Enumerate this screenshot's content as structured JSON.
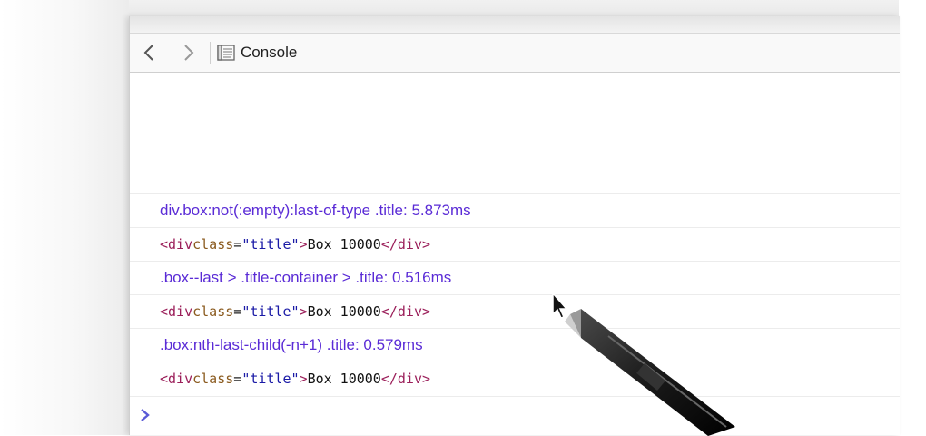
{
  "toolbar": {
    "back_icon": "chevron-left-icon",
    "forward_icon": "chevron-right-icon",
    "console_icon": "console-icon",
    "console_label": "Console"
  },
  "log": {
    "entries": [
      {
        "type": "message",
        "text": "div.box:not(:empty):last-of-type .title: 5.873ms"
      },
      {
        "type": "element",
        "tag_open": "<div",
        "attr_name": " class",
        "eq": "=",
        "attr_value": "\"title\"",
        "tag_close": ">",
        "text": "Box 10000",
        "end_tag": "</div>"
      },
      {
        "type": "message",
        "text": ".box--last > .title-container > .title: 0.516ms"
      },
      {
        "type": "element",
        "tag_open": "<div",
        "attr_name": " class",
        "eq": "=",
        "attr_value": "\"title\"",
        "tag_close": ">",
        "text": "Box 10000",
        "end_tag": "</div>"
      },
      {
        "type": "message",
        "text": ".box:nth-last-child(-n+1) .title: 0.579ms"
      },
      {
        "type": "element",
        "tag_open": "<div",
        "attr_name": " class",
        "eq": "=",
        "attr_value": "\"title\"",
        "tag_close": ">",
        "text": "Box 10000",
        "end_tag": "</div>"
      }
    ]
  },
  "prompt": {
    "icon": "prompt-chevron-icon"
  },
  "colors": {
    "message": "#5a2bd6",
    "tag": "#9b1f5a",
    "attr": "#8a5a1e",
    "value": "#1a1aa6",
    "prompt": "#5a5ad6"
  }
}
